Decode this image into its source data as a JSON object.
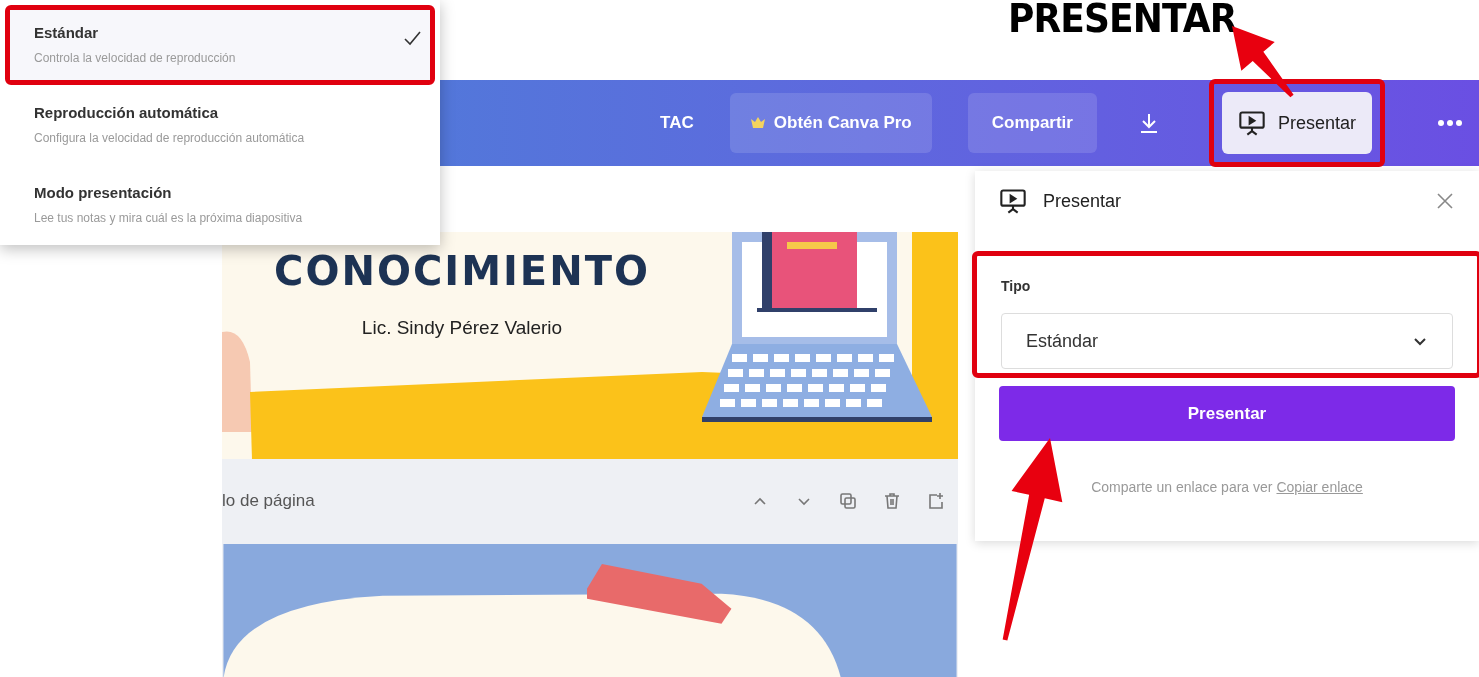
{
  "annotation": {
    "label": "PRESENTAR"
  },
  "menu": {
    "items": [
      {
        "title": "Estándar",
        "description": "Controla la velocidad de reproducción",
        "selected": true,
        "highlighted": true
      },
      {
        "title": "Reproducción automática",
        "description": "Configura la velocidad de reproducción automática",
        "selected": false,
        "highlighted": false
      },
      {
        "title": "Modo presentación",
        "description": "Lee tus notas y mira cuál es la próxima diapositiva",
        "selected": false,
        "highlighted": false
      }
    ]
  },
  "toolbar": {
    "title": "TAC",
    "items": [
      {
        "kind": "pro",
        "label": "Obtén Canva Pro"
      },
      {
        "kind": "button",
        "label": "Compartir"
      },
      {
        "kind": "download"
      },
      {
        "kind": "present",
        "label": "Presentar",
        "highlighted": true
      },
      {
        "kind": "more"
      }
    ]
  },
  "editor": {
    "slide": {
      "title": "CONOCIMIENTO",
      "subtitle": "Lic. Sindy Pérez Valerio"
    },
    "page_header": "lo de página"
  },
  "panel": {
    "title": "Presentar",
    "field": {
      "label": "Tipo",
      "value": "Estándar",
      "highlighted": true
    },
    "button": "Presentar",
    "share_text": "Comparte un enlace para ver",
    "link": "Copiar enlace"
  }
}
